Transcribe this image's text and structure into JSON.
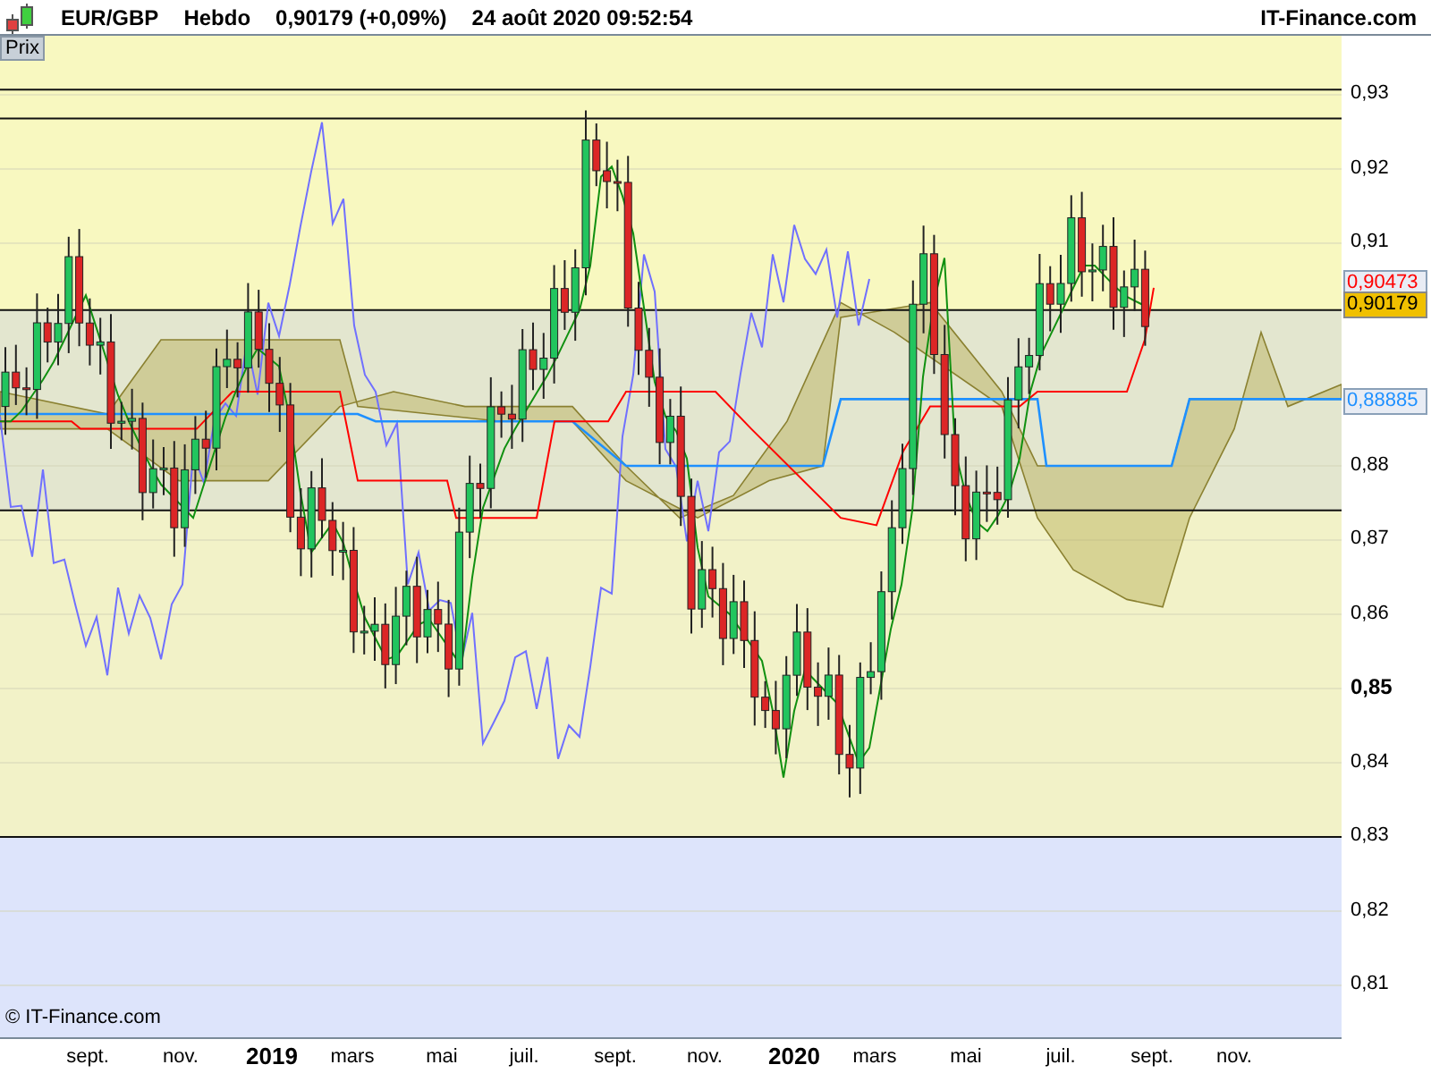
{
  "header": {
    "symbol": "EUR/GBP",
    "period": "Hebdo",
    "quote": "0,90179 (+0,09%)",
    "datetime": "24 août 2020 09:52:54",
    "brand": "IT-Finance.com"
  },
  "panel_tab": {
    "label": "Prix"
  },
  "watermark_credit": "© IT-Finance.com",
  "y_axis": [
    {
      "label": "0,93",
      "major": false
    },
    {
      "label": "0,92",
      "major": false
    },
    {
      "label": "0,91",
      "major": false
    },
    {
      "label": "0,88",
      "major": false
    },
    {
      "label": "0,87",
      "major": false
    },
    {
      "label": "0,86",
      "major": false
    },
    {
      "label": "0,85",
      "major": true
    },
    {
      "label": "0,84",
      "major": false
    },
    {
      "label": "0,83",
      "major": false
    },
    {
      "label": "0,82",
      "major": false
    },
    {
      "label": "0,81",
      "major": false
    }
  ],
  "price_tags": [
    {
      "label": "0,90473",
      "kind": "outline",
      "color": "#ff0000"
    },
    {
      "label": "0,90179",
      "kind": "filled",
      "color": "#f0c000"
    },
    {
      "label": "0,88885",
      "kind": "outline",
      "color": "#1e90ff"
    }
  ],
  "x_axis": [
    {
      "label": "sept.",
      "kind": "month"
    },
    {
      "label": "nov.",
      "kind": "month"
    },
    {
      "label": "2019",
      "kind": "year"
    },
    {
      "label": "mars",
      "kind": "month"
    },
    {
      "label": "mai",
      "kind": "month"
    },
    {
      "label": "juil.",
      "kind": "month"
    },
    {
      "label": "sept.",
      "kind": "month"
    },
    {
      "label": "nov.",
      "kind": "month"
    },
    {
      "label": "2020",
      "kind": "year"
    },
    {
      "label": "mars",
      "kind": "month"
    },
    {
      "label": "mai",
      "kind": "month"
    },
    {
      "label": "juil.",
      "kind": "month"
    },
    {
      "label": "sept.",
      "kind": "month"
    },
    {
      "label": "nov.",
      "kind": "month"
    }
  ]
}
